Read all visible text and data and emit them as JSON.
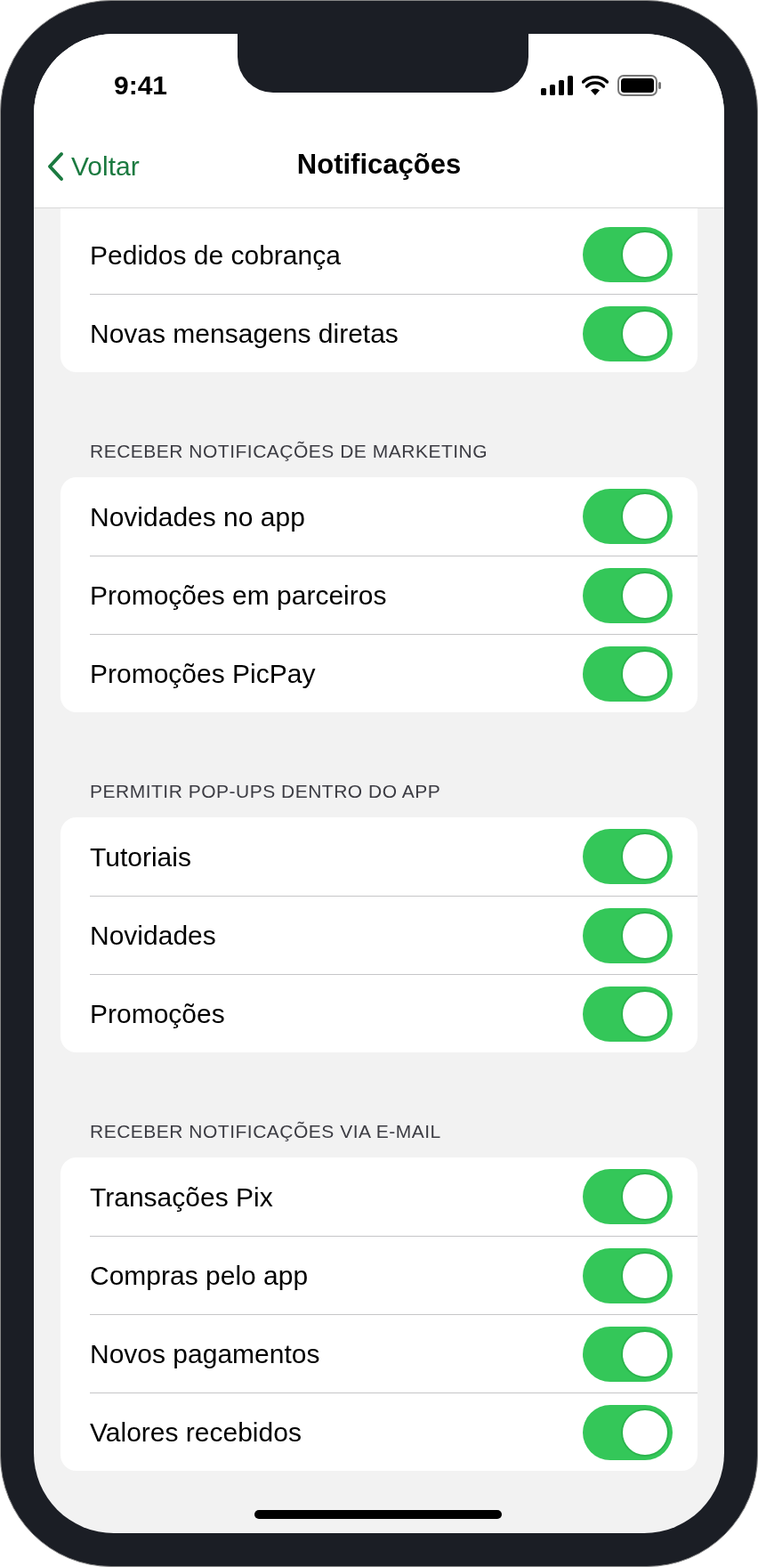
{
  "status_bar": {
    "time": "9:41"
  },
  "nav": {
    "back_label": "Voltar",
    "title": "Notificações"
  },
  "sections": [
    {
      "rows": [
        {
          "label": "Pedidos de cobrança",
          "on": true
        },
        {
          "label": "Novas mensagens diretas",
          "on": true
        }
      ]
    },
    {
      "header": "RECEBER NOTIFICAÇÕES DE MARKETING",
      "rows": [
        {
          "label": "Novidades no app",
          "on": true
        },
        {
          "label": "Promoções em parceiros",
          "on": true
        },
        {
          "label": "Promoções PicPay",
          "on": true
        }
      ]
    },
    {
      "header": "PERMITIR POP-UPS DENTRO DO APP",
      "rows": [
        {
          "label": "Tutoriais",
          "on": true
        },
        {
          "label": "Novidades",
          "on": true
        },
        {
          "label": "Promoções",
          "on": true
        }
      ]
    },
    {
      "header": "RECEBER NOTIFICAÇÕES VIA E-MAIL",
      "rows": [
        {
          "label": "Transações Pix",
          "on": true
        },
        {
          "label": "Compras pelo app",
          "on": true
        },
        {
          "label": "Novos pagamentos",
          "on": true
        },
        {
          "label": "Valores recebidos",
          "on": true
        }
      ]
    }
  ]
}
